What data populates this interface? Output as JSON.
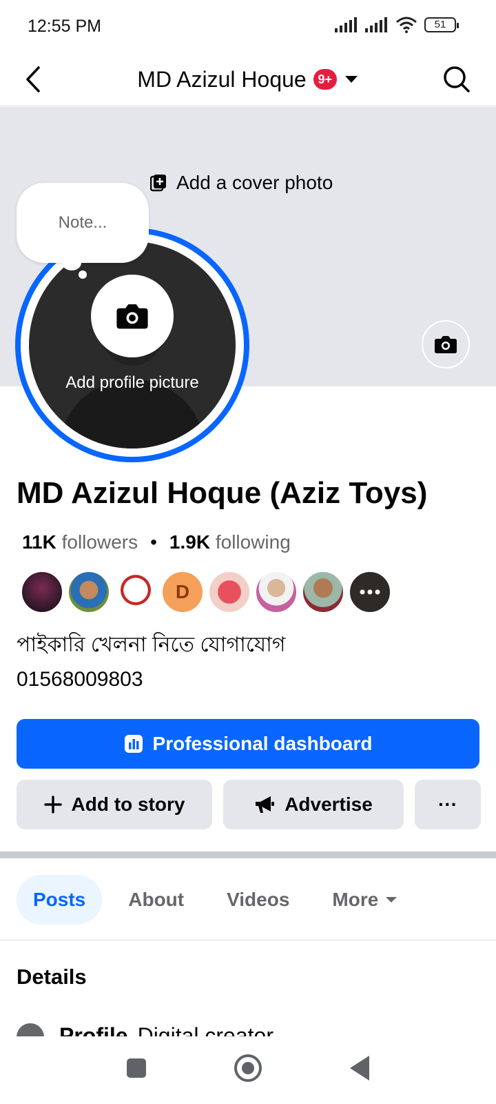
{
  "status_bar": {
    "time": "12:55 PM",
    "battery": "51"
  },
  "header": {
    "title": "MD Azizul Hoque",
    "badge": "9+"
  },
  "cover": {
    "add_cover_label": "Add a cover photo"
  },
  "profile_photo": {
    "add_label": "Add profile picture"
  },
  "note": {
    "placeholder": "Note..."
  },
  "profile": {
    "name": "MD Azizul Hoque (Aziz Toys)",
    "followers_count": "11K",
    "followers_label": "followers",
    "separator": "•",
    "following_count": "1.9K",
    "following_label": "following",
    "friend_avatar_initial": "D",
    "bio_line1": "পাইকারি খেলনা নিতে যোগাযোগ",
    "bio_line2": "01568009803"
  },
  "actions": {
    "dashboard_label": "Professional dashboard",
    "story_label": "Add to story",
    "advertise_label": "Advertise",
    "more_label": "···"
  },
  "tabs": [
    {
      "label": "Posts",
      "active": true
    },
    {
      "label": "About",
      "active": false
    },
    {
      "label": "Videos",
      "active": false
    },
    {
      "label": "More",
      "active": false
    }
  ],
  "details": {
    "heading": "Details",
    "row_label": "Profile",
    "row_value": "Digital creator"
  },
  "colors": {
    "accent": "#0866ff",
    "badge": "#e41e3f",
    "cover_bg": "#e4e6eb"
  }
}
